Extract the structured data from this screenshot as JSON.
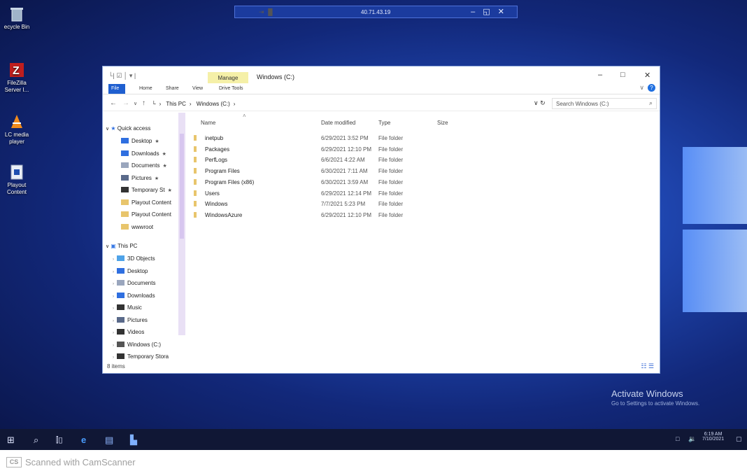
{
  "desktop": {
    "icons": [
      {
        "label": "ecycle Bin",
        "icon": "recycle-bin-icon"
      },
      {
        "label": "FileZilla Server I...",
        "icon": "filezilla-icon"
      },
      {
        "label": "LC media player",
        "icon": "vlc-icon"
      },
      {
        "label": "Playout Content",
        "icon": "shortcut-file-icon"
      }
    ],
    "watermark": {
      "title": "Activate Windows",
      "subtitle": "Go to Settings to activate Windows."
    }
  },
  "rdp_bar": {
    "ip": "40.71.43.19"
  },
  "explorer": {
    "qat": "└| ☑ │ ▾ |",
    "manage_tab": "Manage",
    "title": "Windows (C:)",
    "ribbon_tabs": [
      "File",
      "Home",
      "Share",
      "View",
      "Drive Tools"
    ],
    "breadcrumb": [
      "This PC",
      "Windows (C:)"
    ],
    "search_placeholder": "Search Windows (C:)",
    "columns": [
      "Name",
      "Date modified",
      "Type",
      "Size"
    ],
    "nav": {
      "quick_access_label": "Quick access",
      "quick_items": [
        {
          "label": "Desktop",
          "pinned": true
        },
        {
          "label": "Downloads",
          "pinned": true
        },
        {
          "label": "Documents",
          "pinned": true
        },
        {
          "label": "Pictures",
          "pinned": true
        },
        {
          "label": "Temporary St",
          "pinned": true
        },
        {
          "label": "Playout Content",
          "pinned": false
        },
        {
          "label": "Playout Content",
          "pinned": false
        },
        {
          "label": "wwwroot",
          "pinned": false
        }
      ],
      "this_pc_label": "This PC",
      "pc_items": [
        "3D Objects",
        "Desktop",
        "Documents",
        "Downloads",
        "Music",
        "Pictures",
        "Videos",
        "Windows (C:)",
        "Temporary Stora"
      ]
    },
    "files": [
      {
        "name": "inetpub",
        "date": "6/29/2021 3:52 PM",
        "type": "File folder"
      },
      {
        "name": "Packages",
        "date": "6/29/2021 12:10 PM",
        "type": "File folder"
      },
      {
        "name": "PerfLogs",
        "date": "6/6/2021 4:22 AM",
        "type": "File folder"
      },
      {
        "name": "Program Files",
        "date": "6/30/2021 7:11 AM",
        "type": "File folder"
      },
      {
        "name": "Program Files (x86)",
        "date": "6/30/2021 3:59 AM",
        "type": "File folder"
      },
      {
        "name": "Users",
        "date": "6/29/2021 12:14 PM",
        "type": "File folder"
      },
      {
        "name": "Windows",
        "date": "7/7/2021 5:23 PM",
        "type": "File folder"
      },
      {
        "name": "WindowsAzure",
        "date": "6/29/2021 12:10 PM",
        "type": "File folder"
      }
    ],
    "status": "8 items"
  },
  "taskbar": {
    "time": "6:19 AM",
    "date": "7/10/2021"
  },
  "scan_footer": {
    "badge": "CS",
    "text": "Scanned with CamScanner"
  }
}
